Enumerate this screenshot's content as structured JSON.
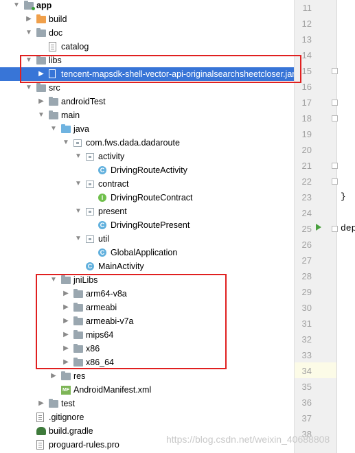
{
  "tree": [
    {
      "label": "app",
      "bold": true,
      "arrow": "down",
      "icon": "module-folder",
      "level": 0
    },
    {
      "label": "build",
      "arrow": "right",
      "icon": "folder-orange",
      "level": 1
    },
    {
      "label": "doc",
      "arrow": "down",
      "icon": "folder",
      "level": 1
    },
    {
      "label": "catalog",
      "arrow": "",
      "icon": "file",
      "level": 2
    },
    {
      "label": "libs",
      "arrow": "down",
      "icon": "folder",
      "level": 1
    },
    {
      "label": "tencent-mapsdk-shell-vector-api-originalsearchsheetcloser.jar",
      "arrow": "right",
      "icon": "jar",
      "level": 2,
      "selected": true
    },
    {
      "label": "src",
      "arrow": "down",
      "icon": "folder",
      "level": 1
    },
    {
      "label": "androidTest",
      "arrow": "right",
      "icon": "folder",
      "level": 2
    },
    {
      "label": "main",
      "arrow": "down",
      "icon": "folder",
      "level": 2
    },
    {
      "label": "java",
      "arrow": "down",
      "icon": "folder-blue",
      "level": 3
    },
    {
      "label": "com.fws.dada.dadaroute",
      "arrow": "down",
      "icon": "package",
      "level": 4
    },
    {
      "label": "activity",
      "arrow": "down",
      "icon": "package",
      "level": 5
    },
    {
      "label": "DrivingRouteActivity",
      "arrow": "",
      "icon": "class",
      "level": 6
    },
    {
      "label": "contract",
      "arrow": "down",
      "icon": "package",
      "level": 5
    },
    {
      "label": "DrivingRouteContract",
      "arrow": "",
      "icon": "interface",
      "level": 6
    },
    {
      "label": "present",
      "arrow": "down",
      "icon": "package",
      "level": 5
    },
    {
      "label": "DrivingRoutePresent",
      "arrow": "",
      "icon": "class",
      "level": 6
    },
    {
      "label": "util",
      "arrow": "down",
      "icon": "package",
      "level": 5
    },
    {
      "label": "GlobalApplication",
      "arrow": "",
      "icon": "class",
      "level": 6
    },
    {
      "label": "MainActivity",
      "arrow": "",
      "icon": "class",
      "level": 5
    },
    {
      "label": "jniLibs",
      "arrow": "down",
      "icon": "folder",
      "level": 3
    },
    {
      "label": "arm64-v8a",
      "arrow": "right",
      "icon": "folder",
      "level": 4
    },
    {
      "label": "armeabi",
      "arrow": "right",
      "icon": "folder",
      "level": 4
    },
    {
      "label": "armeabi-v7a",
      "arrow": "right",
      "icon": "folder",
      "level": 4
    },
    {
      "label": "mips64",
      "arrow": "right",
      "icon": "folder",
      "level": 4
    },
    {
      "label": "x86",
      "arrow": "right",
      "icon": "folder",
      "level": 4
    },
    {
      "label": "x86_64",
      "arrow": "right",
      "icon": "folder",
      "level": 4
    },
    {
      "label": "res",
      "arrow": "right",
      "icon": "folder-res",
      "level": 3
    },
    {
      "label": "AndroidManifest.xml",
      "arrow": "",
      "icon": "manifest",
      "level": 3
    },
    {
      "label": "test",
      "arrow": "right",
      "icon": "folder",
      "level": 2
    },
    {
      "label": ".gitignore",
      "arrow": "",
      "icon": "file",
      "level": 1
    },
    {
      "label": "build.gradle",
      "arrow": "",
      "icon": "gradle",
      "level": 1
    },
    {
      "label": "proguard-rules.pro",
      "arrow": "",
      "icon": "file",
      "level": 1
    }
  ],
  "gutter": {
    "line_numbers": [
      "11",
      "12",
      "13",
      "14",
      "15",
      "16",
      "17",
      "18",
      "19",
      "20",
      "21",
      "22",
      "23",
      "24",
      "25",
      "26",
      "27",
      "28",
      "29",
      "30",
      "31",
      "32",
      "33",
      "34",
      "35",
      "36",
      "37",
      "38"
    ],
    "code_fragments": [
      {
        "line": "23",
        "text": "}"
      },
      {
        "line": "25",
        "text": "dep"
      }
    ]
  },
  "watermark": "https://blog.csdn.net/weixin_40688808"
}
